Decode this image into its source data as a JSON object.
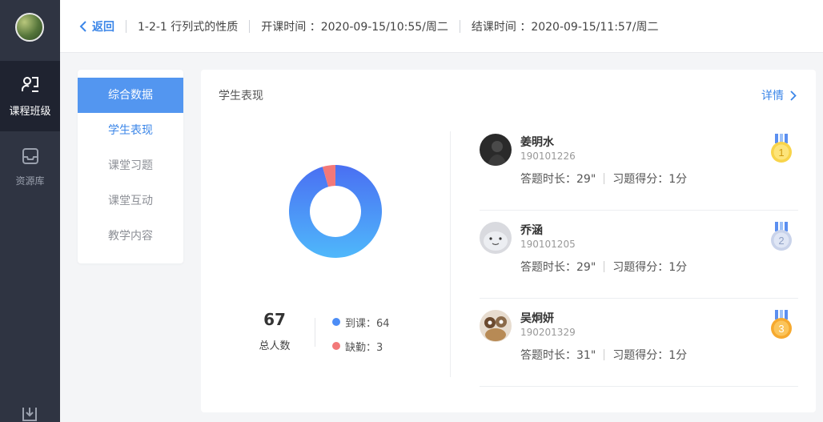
{
  "nav": {
    "items": [
      {
        "label": "课程班级",
        "icon": "class-icon"
      },
      {
        "label": "资源库",
        "icon": "inbox-icon"
      }
    ]
  },
  "header": {
    "back_label": "返回",
    "lesson": "1-2-1 行列式的性质",
    "start": "开课时间 ：2020-09-15/10:55/周二",
    "end": "结课时间 ：2020-09-15/11:57/周二"
  },
  "submenu": {
    "items": [
      "综合数据",
      "学生表现",
      "课堂习题",
      "课堂互动",
      "教学内容"
    ]
  },
  "card": {
    "title": "学生表现",
    "detail_label": "详情"
  },
  "attendance": {
    "total": "67",
    "total_label": "总人数",
    "present_label": "到课：64",
    "absent_label": "缺勤：3",
    "present": 64,
    "absent": 3,
    "colors": {
      "present": "#4c8df6",
      "absent": "#f27878"
    }
  },
  "students": [
    {
      "name": "姜明水",
      "id": "190101226",
      "duration": "答题时长：29\"",
      "score": "习题得分：1分",
      "rank": "1"
    },
    {
      "name": "乔涵",
      "id": "190101205",
      "duration": "答题时长：29\"",
      "score": "习题得分：1分",
      "rank": "2"
    },
    {
      "name": "吴炯妍",
      "id": "190201329",
      "duration": "答题时长：31\"",
      "score": "习题得分：1分",
      "rank": "3"
    }
  ]
}
